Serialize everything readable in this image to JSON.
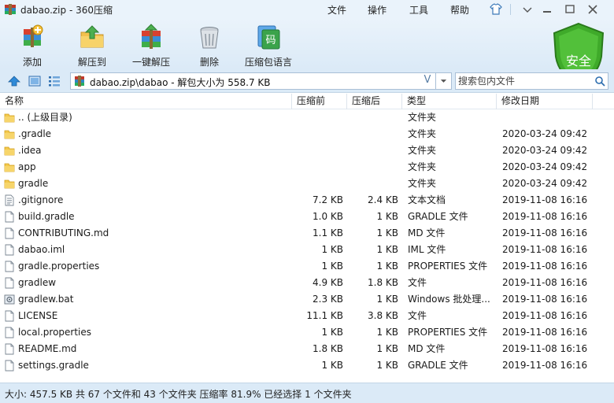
{
  "window": {
    "title": "dabao.zip - 360压缩",
    "menu": [
      "文件",
      "操作",
      "工具",
      "帮助"
    ]
  },
  "toolbar": {
    "buttons": [
      {
        "label": "添加",
        "icon": "add-archive-icon"
      },
      {
        "label": "解压到",
        "icon": "extract-to-icon"
      },
      {
        "label": "一键解压",
        "icon": "one-click-extract-icon"
      },
      {
        "label": "删除",
        "icon": "delete-trash-icon"
      },
      {
        "label": "压缩包语言",
        "icon": "archive-language-icon"
      }
    ],
    "shield_label": "安全",
    "language_glyph": "码"
  },
  "address": {
    "path": "dabao.zip\\dabao - 解包大小为 558.7 KB",
    "history_glyph": "V"
  },
  "search": {
    "placeholder": "搜索包内文件"
  },
  "columns": {
    "name": "名称",
    "size": "压缩前",
    "compressed": "压缩后",
    "type": "类型",
    "modified": "修改日期"
  },
  "files": [
    {
      "name": ".. (上级目录)",
      "size": "",
      "compressed": "",
      "type": "文件夹",
      "modified": "",
      "icon": "folder-icon"
    },
    {
      "name": ".gradle",
      "size": "",
      "compressed": "",
      "type": "文件夹",
      "modified": "2020-03-24 09:42",
      "icon": "folder-icon"
    },
    {
      "name": ".idea",
      "size": "",
      "compressed": "",
      "type": "文件夹",
      "modified": "2020-03-24 09:42",
      "icon": "folder-icon"
    },
    {
      "name": "app",
      "size": "",
      "compressed": "",
      "type": "文件夹",
      "modified": "2020-03-24 09:42",
      "icon": "folder-icon"
    },
    {
      "name": "gradle",
      "size": "",
      "compressed": "",
      "type": "文件夹",
      "modified": "2020-03-24 09:42",
      "icon": "folder-icon"
    },
    {
      "name": ".gitignore",
      "size": "7.2 KB",
      "compressed": "2.4 KB",
      "type": "文本文档",
      "modified": "2019-11-08 16:16",
      "icon": "text-file-icon"
    },
    {
      "name": "build.gradle",
      "size": "1.0 KB",
      "compressed": "1 KB",
      "type": "GRADLE 文件",
      "modified": "2019-11-08 16:16",
      "icon": "file-icon"
    },
    {
      "name": "CONTRIBUTING.md",
      "size": "1.1 KB",
      "compressed": "1 KB",
      "type": "MD 文件",
      "modified": "2019-11-08 16:16",
      "icon": "file-icon"
    },
    {
      "name": "dabao.iml",
      "size": "1 KB",
      "compressed": "1 KB",
      "type": "IML 文件",
      "modified": "2019-11-08 16:16",
      "icon": "file-icon"
    },
    {
      "name": "gradle.properties",
      "size": "1 KB",
      "compressed": "1 KB",
      "type": "PROPERTIES 文件",
      "modified": "2019-11-08 16:16",
      "icon": "file-icon"
    },
    {
      "name": "gradlew",
      "size": "4.9 KB",
      "compressed": "1.8 KB",
      "type": "文件",
      "modified": "2019-11-08 16:16",
      "icon": "file-icon"
    },
    {
      "name": "gradlew.bat",
      "size": "2.3 KB",
      "compressed": "1 KB",
      "type": "Windows 批处理...",
      "modified": "2019-11-08 16:16",
      "icon": "batch-file-icon"
    },
    {
      "name": "LICENSE",
      "size": "11.1 KB",
      "compressed": "3.8 KB",
      "type": "文件",
      "modified": "2019-11-08 16:16",
      "icon": "file-icon"
    },
    {
      "name": "local.properties",
      "size": "1 KB",
      "compressed": "1 KB",
      "type": "PROPERTIES 文件",
      "modified": "2019-11-08 16:16",
      "icon": "file-icon"
    },
    {
      "name": "README.md",
      "size": "1.8 KB",
      "compressed": "1 KB",
      "type": "MD 文件",
      "modified": "2019-11-08 16:16",
      "icon": "file-icon"
    },
    {
      "name": "settings.gradle",
      "size": "1 KB",
      "compressed": "1 KB",
      "type": "GRADLE 文件",
      "modified": "2019-11-08 16:16",
      "icon": "file-icon"
    }
  ],
  "status": "大小: 457.5 KB 共 67 个文件和 43 个文件夹 压缩率 81.9% 已经选择 1 个文件夹",
  "colors": {
    "chrome": "#dbeaf7",
    "titlebar": "#eaf3fb",
    "folder": "#f3c94d",
    "shield": "#3faa2a"
  }
}
